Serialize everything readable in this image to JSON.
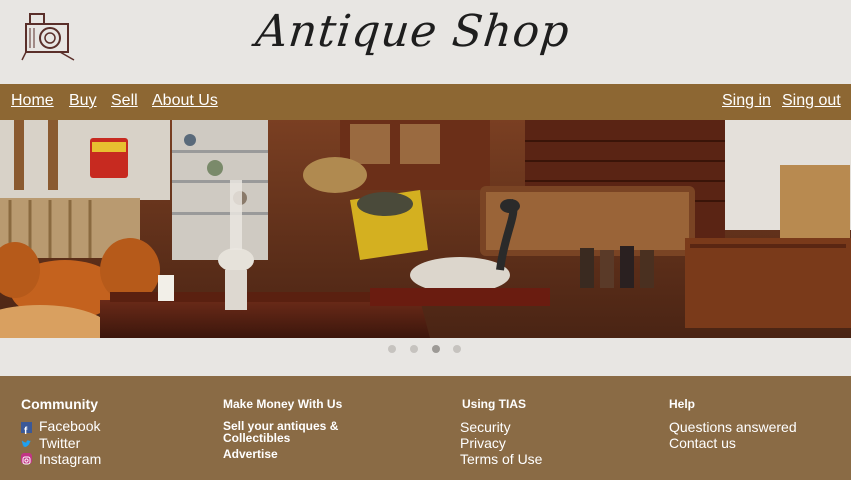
{
  "header": {
    "brand_text": "Antique Shop",
    "logo_icon": "camera-icon"
  },
  "nav": {
    "left": [
      "Home",
      "Buy",
      "Sell",
      "About Us"
    ],
    "right": [
      "Sing in",
      "Sing out"
    ]
  },
  "carousel": {
    "slide_count": 4,
    "active_index": 2
  },
  "footer": {
    "community": {
      "title": "Community",
      "links": [
        "Facebook",
        "Twitter",
        "Instagram"
      ],
      "icons": [
        "facebook-icon",
        "twitter-icon",
        "instagram-icon"
      ]
    },
    "make_money": {
      "title": "Make Money With Us",
      "links": [
        "Sell your antiques & Collectibles",
        "Advertise"
      ]
    },
    "using_tias": {
      "title": "Using TIAS",
      "links": [
        "Security",
        "Privacy",
        "Terms of Use"
      ]
    },
    "help": {
      "title": "Help",
      "links": [
        "Questions answered",
        "Contact us"
      ]
    }
  },
  "colors": {
    "header_bg": "#e8e6e3",
    "nav_bg": "#8d6733",
    "footer_bg": "#8a6b45",
    "facebook": "#3b5998",
    "twitter": "#1da1f2",
    "instagram": "#c13584"
  }
}
